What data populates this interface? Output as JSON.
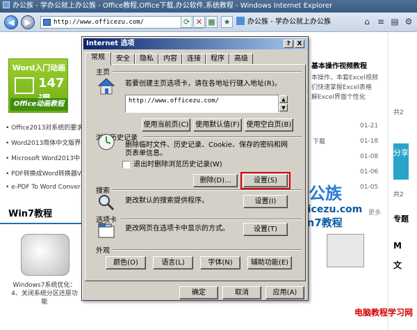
{
  "browser": {
    "title": "办公族 - 学办公就上办公族 - Office教程,Office下载,办公软件,系统教程 - Windows Internet Explorer",
    "address": "http://www.officezu.com/",
    "tab_title": "办公族 - 学办公就上办公族",
    "back": "◀",
    "forward": "▶"
  },
  "page": {
    "promo": {
      "title": "Word入门动画",
      "count": "147课",
      "footer": "Office动画教程"
    },
    "list": [
      "Office2013对系统的要求",
      "Word2013简体中文版界面",
      "Microsoft Word2013中",
      "PDF转换成Word转换器V",
      "e-PDF To Word Conver"
    ],
    "right_dates": [
      "01-21",
      "01-18",
      "01-08",
      "01-06",
      "01-05"
    ],
    "right_header": "基本操作视频教程",
    "right_desc": [
      "本操作，本套Excel视频",
      "们快速掌握Excel表格",
      "解Excel界面个性化"
    ],
    "right_misc": [
      "下载",
      "共2"
    ],
    "share": "分享",
    "win7_title": "Win7教程",
    "win7_more": "更多",
    "win7_caption": "Windows7系统优化：4、关闭系统分区还原功能",
    "logo_cn": "办公族",
    "logo_url": "Officezu.com",
    "logo_tag": "Win7教程",
    "watermark": "电脑教程学习网",
    "side_labels": [
      "共2",
      "共2",
      "专题",
      "M",
      "文"
    ]
  },
  "dialog": {
    "title": "Internet 选项",
    "help": "?",
    "close": "X",
    "tabs": [
      "常规",
      "安全",
      "隐私",
      "内容",
      "连接",
      "程序",
      "高级"
    ],
    "home": {
      "section": "主页",
      "desc": "若要创建主页选项卡，请在各地址行键入地址(R)。",
      "url": "http://www.officezu.com/",
      "buttons": [
        "使用当前页(C)",
        "使用默认值(F)",
        "使用空白页(B)"
      ]
    },
    "history": {
      "section": "浏览历史记录",
      "desc": "删除临时文件、历史记录、Cookie、保存的密码和网页表单信息。",
      "checkbox": "退出时删除浏览历史记录(W)",
      "delete": "删除(D)...",
      "settings": "设置(S)"
    },
    "search": {
      "section": "搜索",
      "desc": "更改默认的搜索提供程序。",
      "settings": "设置(I)"
    },
    "tabs_section": {
      "section": "选项卡",
      "desc": "更改网页在选项卡中显示的方式。",
      "settings": "设置(T)"
    },
    "appearance": {
      "section": "外观",
      "buttons": [
        "颜色(O)",
        "语言(L)",
        "字体(N)",
        "辅助功能(E)"
      ]
    },
    "footer": {
      "ok": "确定",
      "cancel": "取消",
      "apply": "应用(A)"
    }
  }
}
